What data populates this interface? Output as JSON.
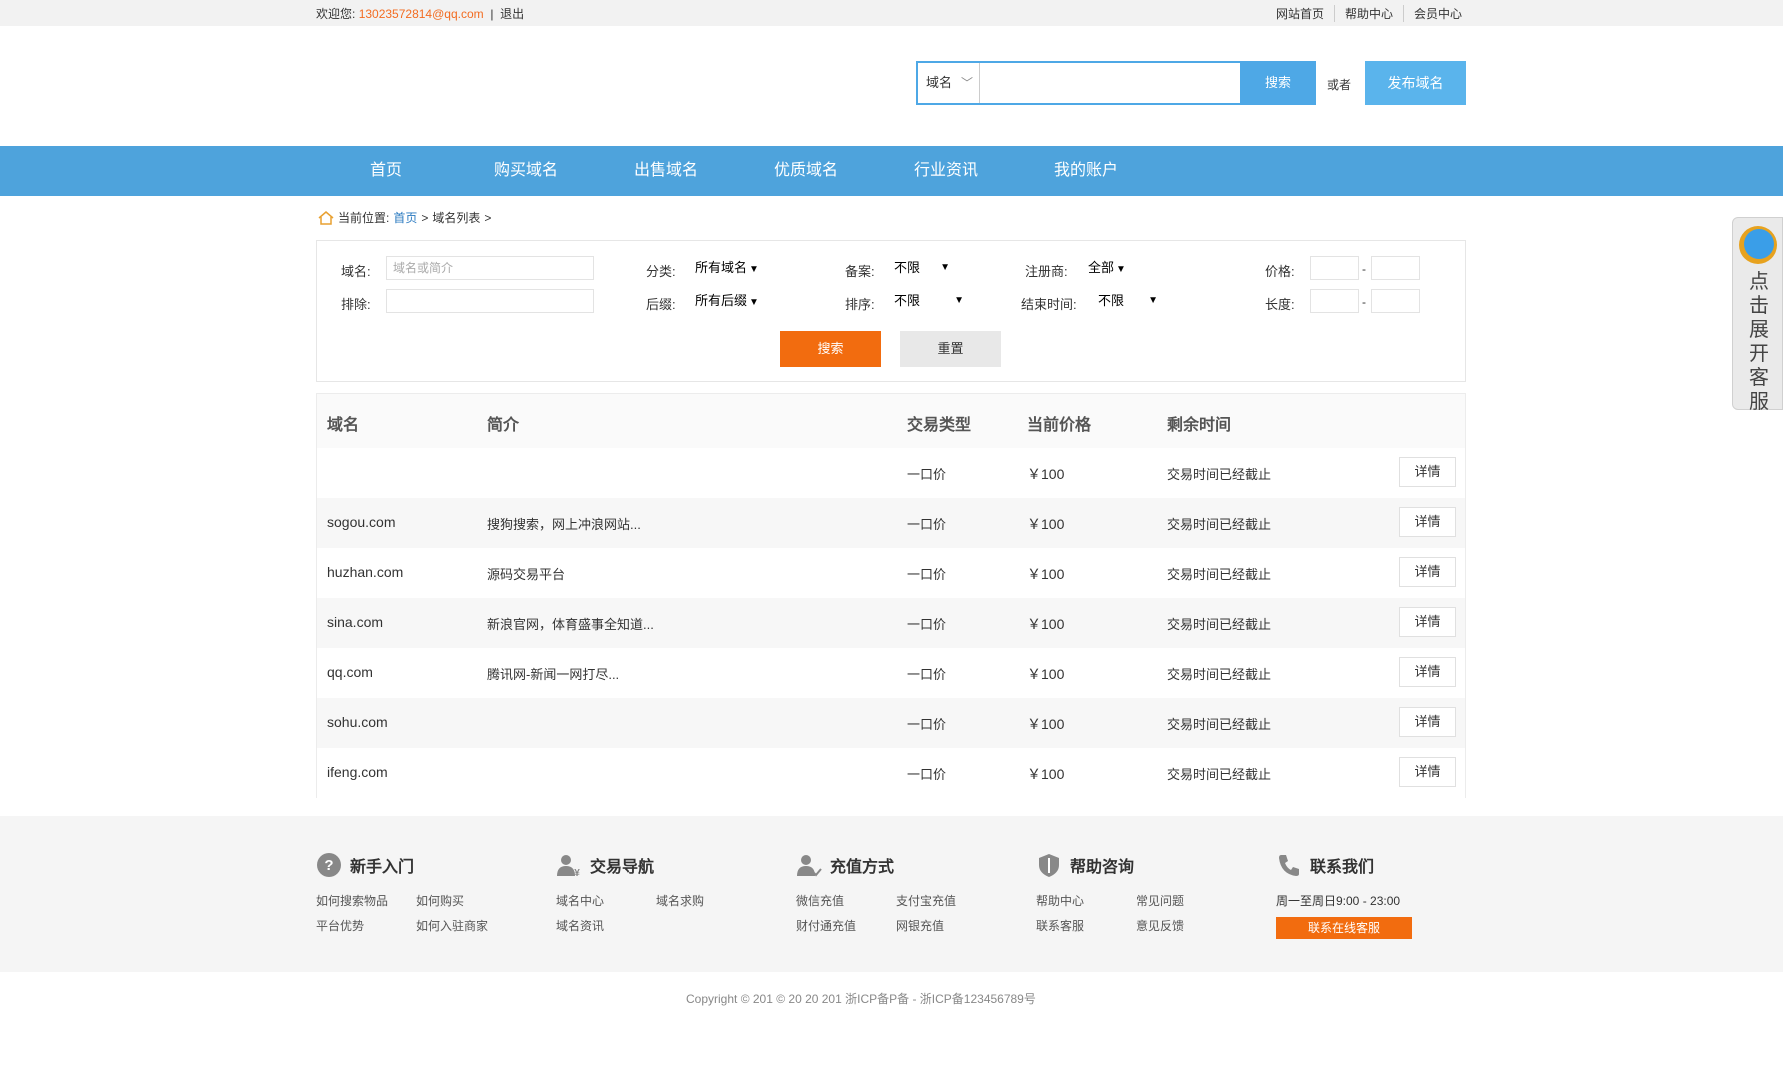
{
  "topbar": {
    "welcome": "欢迎您:",
    "email": "13023572814@qq.com",
    "separator": "|",
    "logout": "退出",
    "links": [
      "网站首页",
      "帮助中心",
      "会员中心"
    ]
  },
  "header": {
    "search_select": "域名",
    "search_placeholder": "",
    "search_button": "搜索",
    "or_text": "或者",
    "publish_button": "发布域名"
  },
  "nav": {
    "items": [
      "首页",
      "购买域名",
      "出售域名",
      "优质域名",
      "行业资讯",
      "我的账户"
    ]
  },
  "breadcrumb": {
    "label": "当前位置:",
    "home": "首页",
    "sep": ">",
    "current": "域名列表",
    "trailing": ">"
  },
  "filter": {
    "domain_label": "域名:",
    "domain_placeholder": "域名或简介",
    "exclude_label": "排除:",
    "category_label": "分类:",
    "category_value": "所有域名",
    "suffix_label": "后缀:",
    "suffix_value": "所有后缀",
    "record_label": "备案:",
    "record_value": "不限",
    "sort_label": "排序:",
    "sort_value": "不限",
    "registrar_label": "注册商:",
    "registrar_value": "全部",
    "end_time_label": "结束时间:",
    "end_time_value": "不限",
    "price_label": "价格:",
    "length_label": "长度:",
    "range_dash": "-",
    "search_button": "搜索",
    "reset_button": "重置"
  },
  "table": {
    "headers": [
      "域名",
      "简介",
      "交易类型",
      "当前价格",
      "剩余时间"
    ],
    "detail_label": "详情",
    "rows": [
      {
        "domain": "",
        "desc": "",
        "type": "一口价",
        "price": "￥100",
        "time": "交易时间已经截止"
      },
      {
        "domain": "sogou.com",
        "desc": "搜狗搜索，网上冲浪网站...",
        "type": "一口价",
        "price": "￥100",
        "time": "交易时间已经截止"
      },
      {
        "domain": "huzhan.com",
        "desc": "源码交易平台",
        "type": "一口价",
        "price": "￥100",
        "time": "交易时间已经截止"
      },
      {
        "domain": "sina.com",
        "desc": "新浪官网，体育盛事全知道...",
        "type": "一口价",
        "price": "￥100",
        "time": "交易时间已经截止"
      },
      {
        "domain": "qq.com",
        "desc": "腾讯网-新闻一网打尽...",
        "type": "一口价",
        "price": "￥100",
        "time": "交易时间已经截止"
      },
      {
        "domain": "sohu.com",
        "desc": "",
        "type": "一口价",
        "price": "￥100",
        "time": "交易时间已经截止"
      },
      {
        "domain": "ifeng.com",
        "desc": "",
        "type": "一口价",
        "price": "￥100",
        "time": "交易时间已经截止"
      }
    ]
  },
  "footer": {
    "cols": [
      {
        "title": "新手入门",
        "icon": "question-icon",
        "links": [
          "如何搜索物品",
          "如何购买",
          "平台优势",
          "如何入驻商家"
        ]
      },
      {
        "title": "交易导航",
        "icon": "user-money-icon",
        "links": [
          "域名中心",
          "域名求购",
          "域名资讯"
        ]
      },
      {
        "title": "充值方式",
        "icon": "user-check-icon",
        "links": [
          "微信充值",
          "支付宝充值",
          "财付通充值",
          "网银充值"
        ]
      },
      {
        "title": "帮助咨询",
        "icon": "shield-icon",
        "links": [
          "帮助中心",
          "常见问题",
          "联系客服",
          "意见反馈"
        ]
      }
    ],
    "contact": {
      "title": "联系我们",
      "icon": "phone-icon",
      "hours": "周一至周日9:00 - 23:00",
      "service_button": "联系在线客服"
    },
    "copyright": "Copyright © 201 © 20 20 201 浙ICP备P备 - 浙ICP备123456789号"
  },
  "side_widget": {
    "text": "点击展开客服"
  },
  "colors": {
    "primary_blue": "#4ea3dc",
    "accent_orange": "#f26c0f",
    "email_orange": "#f36c21"
  }
}
